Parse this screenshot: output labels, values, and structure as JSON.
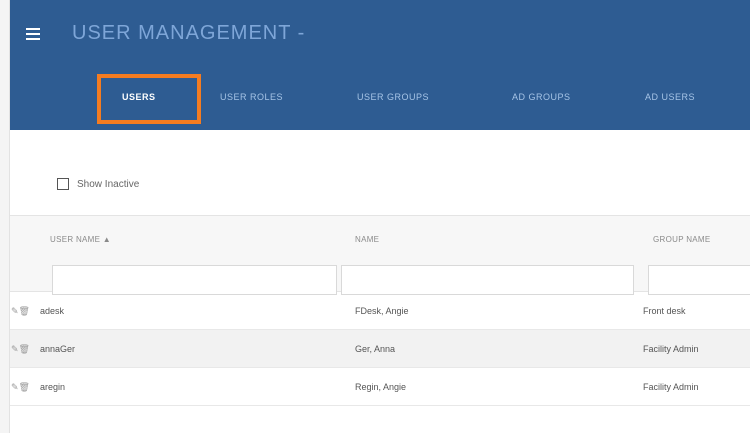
{
  "app": {
    "title": "USER MANAGEMENT",
    "title_suffix": "-"
  },
  "tabs": [
    {
      "label": "USERS",
      "active": true
    },
    {
      "label": "USER ROLES",
      "active": false
    },
    {
      "label": "USER GROUPS",
      "active": false
    },
    {
      "label": "AD GROUPS",
      "active": false
    },
    {
      "label": "AD USERS",
      "active": false
    }
  ],
  "filters": {
    "show_inactive_label": "Show Inactive",
    "show_inactive_checked": false
  },
  "table": {
    "columns": [
      {
        "label": "USER NAME",
        "sort_indicator": "▲"
      },
      {
        "label": "NAME",
        "sort_indicator": ""
      },
      {
        "label": "GROUP NAME",
        "sort_indicator": ""
      }
    ],
    "row_icons": {
      "edit": "✎",
      "delete": "🗑"
    },
    "rows": [
      {
        "username": "adesk",
        "name": "FDesk, Angie",
        "group": "Front desk"
      },
      {
        "username": "annaGer",
        "name": "Ger, Anna",
        "group": "Facility Admin"
      },
      {
        "username": "aregin",
        "name": "Regin, Angie",
        "group": "Facility Admin"
      }
    ]
  },
  "colors": {
    "header_bg": "#2e5c92",
    "highlight": "#f57c20",
    "active_tab": "#ffffff"
  },
  "icons": {
    "menu": "hamburger-menu-icon",
    "edit": "pencil-icon",
    "delete": "trash-icon",
    "sort": "sort-ascending-icon"
  }
}
